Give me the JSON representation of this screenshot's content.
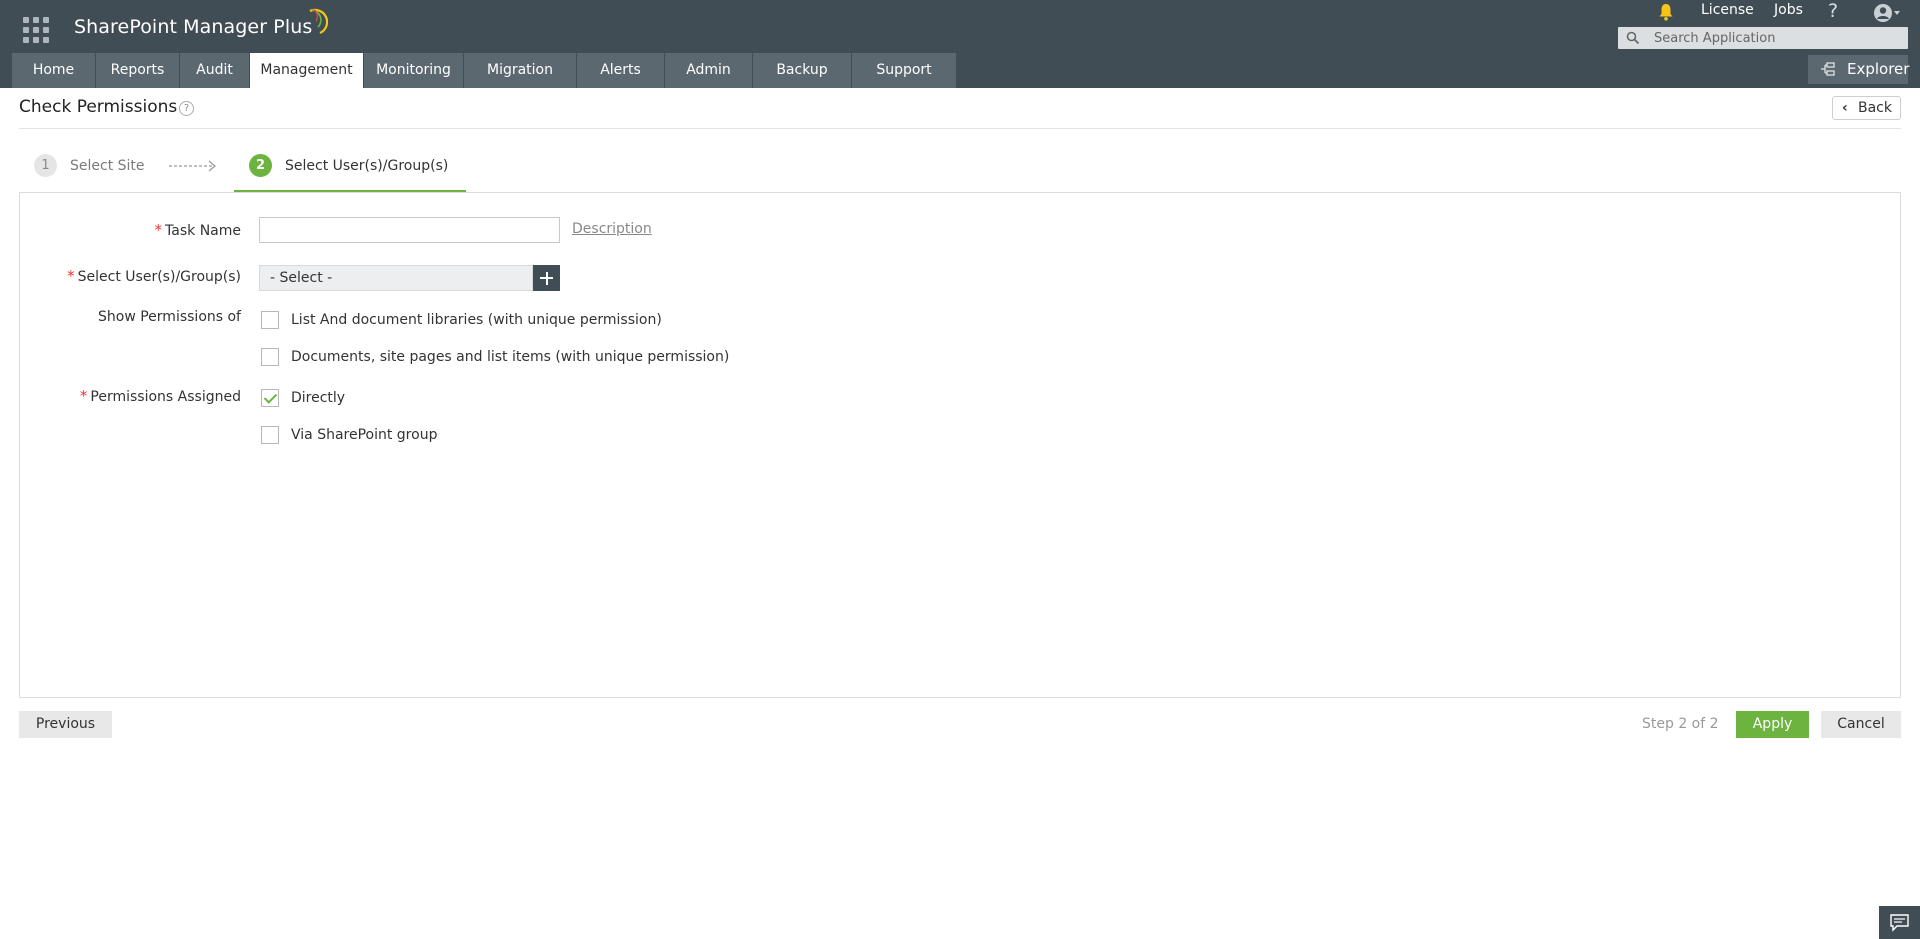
{
  "app": {
    "name": "SharePoint Manager Plus"
  },
  "header": {
    "links": {
      "license": "License",
      "jobs": "Jobs",
      "help": "?"
    },
    "search": {
      "placeholder": "Search Application"
    },
    "explorer_label": "Explorer"
  },
  "nav": {
    "tabs": [
      {
        "label": "Home",
        "active": false
      },
      {
        "label": "Reports",
        "active": false
      },
      {
        "label": "Audit",
        "active": false
      },
      {
        "label": "Management",
        "active": true
      },
      {
        "label": "Monitoring",
        "active": false
      },
      {
        "label": "Migration",
        "active": false
      },
      {
        "label": "Alerts",
        "active": false
      },
      {
        "label": "Admin",
        "active": false
      },
      {
        "label": "Backup",
        "active": false
      },
      {
        "label": "Support",
        "active": false
      }
    ]
  },
  "page": {
    "title": "Check Permissions",
    "help_icon": "?",
    "back_label": "Back"
  },
  "steps": [
    {
      "number": "1",
      "label": "Select Site",
      "active": false
    },
    {
      "number": "2",
      "label": "Select User(s)/Group(s)",
      "active": true
    }
  ],
  "form": {
    "task_name": {
      "label": "Task Name",
      "required": "*",
      "value": ""
    },
    "description_link": "Description",
    "users": {
      "label": "Select User(s)/Group(s)",
      "required": "*",
      "selected": "- Select -"
    },
    "show_permissions": {
      "label": "Show Permissions of",
      "options": [
        {
          "label": "List And document libraries (with unique permission)",
          "checked": false
        },
        {
          "label": "Documents, site pages and list items (with unique permission)",
          "checked": false
        }
      ]
    },
    "permissions_assigned": {
      "label": "Permissions Assigned",
      "required": "*",
      "options": [
        {
          "label": "Directly",
          "checked": true
        },
        {
          "label": "Via SharePoint group",
          "checked": false
        }
      ]
    }
  },
  "footer": {
    "previous_label": "Previous",
    "step_count": "Step 2 of 2",
    "apply_label": "Apply",
    "cancel_label": "Cancel"
  },
  "colors": {
    "header_bg": "#414d55",
    "nav_tab_bg": "#5b6870",
    "accent_green": "#6cb33f",
    "required_red": "#e33333",
    "bell_yellow": "#f5c518"
  }
}
